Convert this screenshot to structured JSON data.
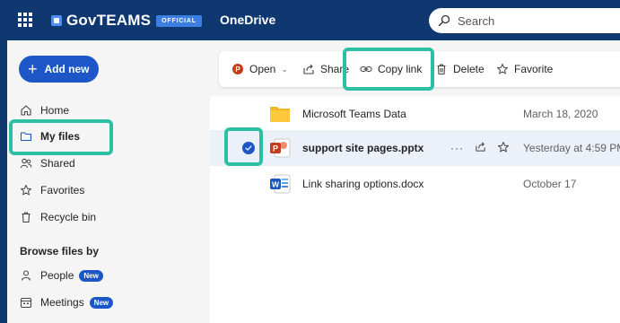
{
  "header": {
    "brand": "GovTEAMS",
    "badge": "OFFICIAL",
    "app_title": "OneDrive",
    "search_placeholder": "Search"
  },
  "sidebar": {
    "add_new": "Add new",
    "items": [
      {
        "label": "Home",
        "icon": "home-icon"
      },
      {
        "label": "My files",
        "icon": "folder-icon"
      },
      {
        "label": "Shared",
        "icon": "people-icon"
      },
      {
        "label": "Favorites",
        "icon": "star-icon"
      },
      {
        "label": "Recycle bin",
        "icon": "trash-icon"
      }
    ],
    "section_title": "Browse files by",
    "browse_items": [
      {
        "label": "People",
        "badge": "New",
        "icon": "person-icon"
      },
      {
        "label": "Meetings",
        "badge": "New",
        "icon": "calendar-icon"
      }
    ]
  },
  "commandbar": {
    "open": "Open",
    "share": "Share",
    "copy_link": "Copy link",
    "delete": "Delete",
    "favorite": "Favorite"
  },
  "files": [
    {
      "name": "Microsoft Teams Data",
      "modified": "March 18, 2020",
      "type": "folder"
    },
    {
      "name": "support site pages.pptx",
      "modified": "Yesterday at 4:59 PM",
      "type": "pptx",
      "selected": true
    },
    {
      "name": "Link sharing options.docx",
      "modified": "October 17",
      "type": "docx"
    }
  ],
  "colors": {
    "header_bg": "#0f3770",
    "accent": "#1d56c7",
    "highlight": "#2bbfa4"
  }
}
